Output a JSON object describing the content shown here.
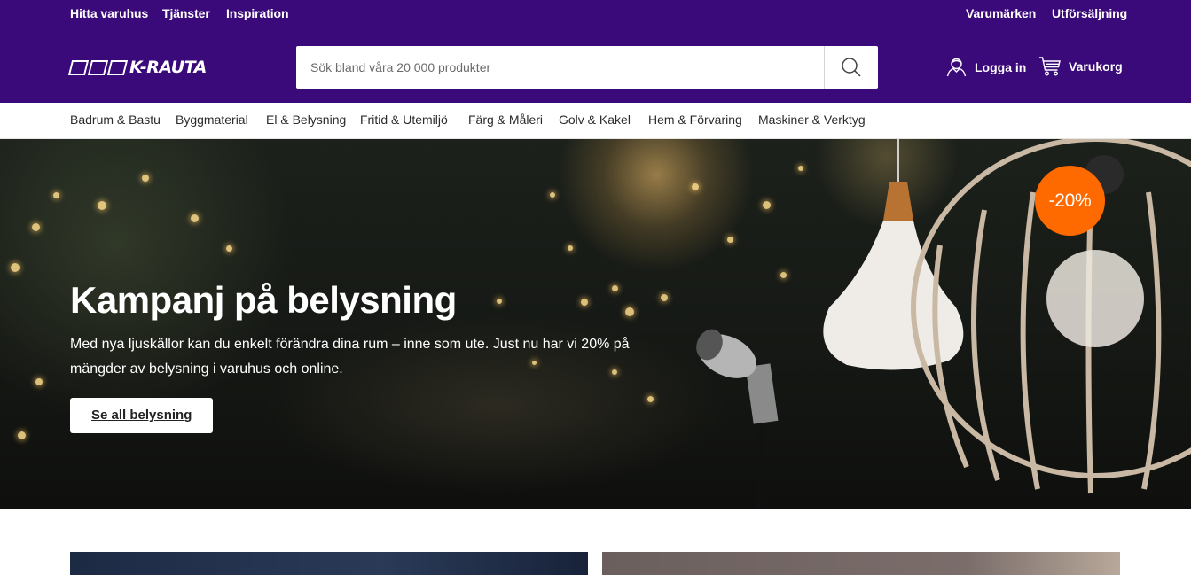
{
  "topbar": {
    "left_links": [
      "Hitta varuhus",
      "Tjänster",
      "Inspiration"
    ],
    "right_links": [
      "Varumärken",
      "Utförsäljning"
    ]
  },
  "header": {
    "logo_text": "K-RAUTA",
    "search": {
      "placeholder": "Sök bland våra 20 000 produkter",
      "value": "",
      "icon": "search-icon"
    },
    "login_label": "Logga in",
    "login_icon": "user-icon",
    "cart_label": "Varukorg",
    "cart_icon": "cart-icon"
  },
  "categories": [
    "Badrum & Bastu",
    "Byggmaterial",
    "El & Belysning",
    "Fritid & Utemiljö",
    "Färg & Måleri",
    "Golv & Kakel",
    "Hem & Förvaring",
    "Maskiner & Verktyg"
  ],
  "hero": {
    "title": "Kampanj på belysning",
    "text": "Med nya ljuskällor kan du enkelt förändra dina rum – inne som ute. Just nu har vi 20% på mängder av belysning i varuhus och online.",
    "button_label": "Se all belysning",
    "badge": "-20%"
  },
  "colors": {
    "brand_purple": "#3a0a7a",
    "badge_orange": "#ff6a00"
  }
}
